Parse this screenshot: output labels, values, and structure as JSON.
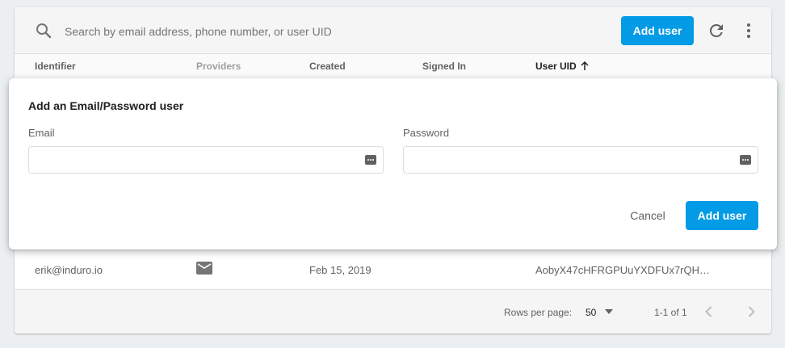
{
  "toolbar": {
    "search_placeholder": "Search by email address, phone number, or user UID",
    "add_user_label": "Add user",
    "search_icon": "search-icon",
    "refresh_icon": "refresh-icon",
    "more_icon": "more-vert-icon"
  },
  "table": {
    "columns": [
      "Identifier",
      "Providers",
      "Created",
      "Signed In",
      "User UID"
    ],
    "sorted_column": "User UID",
    "sort_direction": "ascending",
    "rows": [
      {
        "identifier": "erik@induro.io",
        "provider_icon": "mail-icon",
        "created": "Feb 15, 2019",
        "signed_in": "",
        "uid": "AobyX47cHFRGPUuYXDFUx7rQH…"
      }
    ]
  },
  "footer": {
    "rows_per_page_label": "Rows per page:",
    "rows_per_page_value": "50",
    "range": "1-1 of 1"
  },
  "dialog": {
    "title": "Add an Email/Password user",
    "email_label": "Email",
    "email_value": "",
    "password_label": "Password",
    "password_value": "",
    "cancel_label": "Cancel",
    "add_label": "Add user"
  },
  "colors": {
    "accent": "#039be5",
    "background": "#eceff1"
  }
}
